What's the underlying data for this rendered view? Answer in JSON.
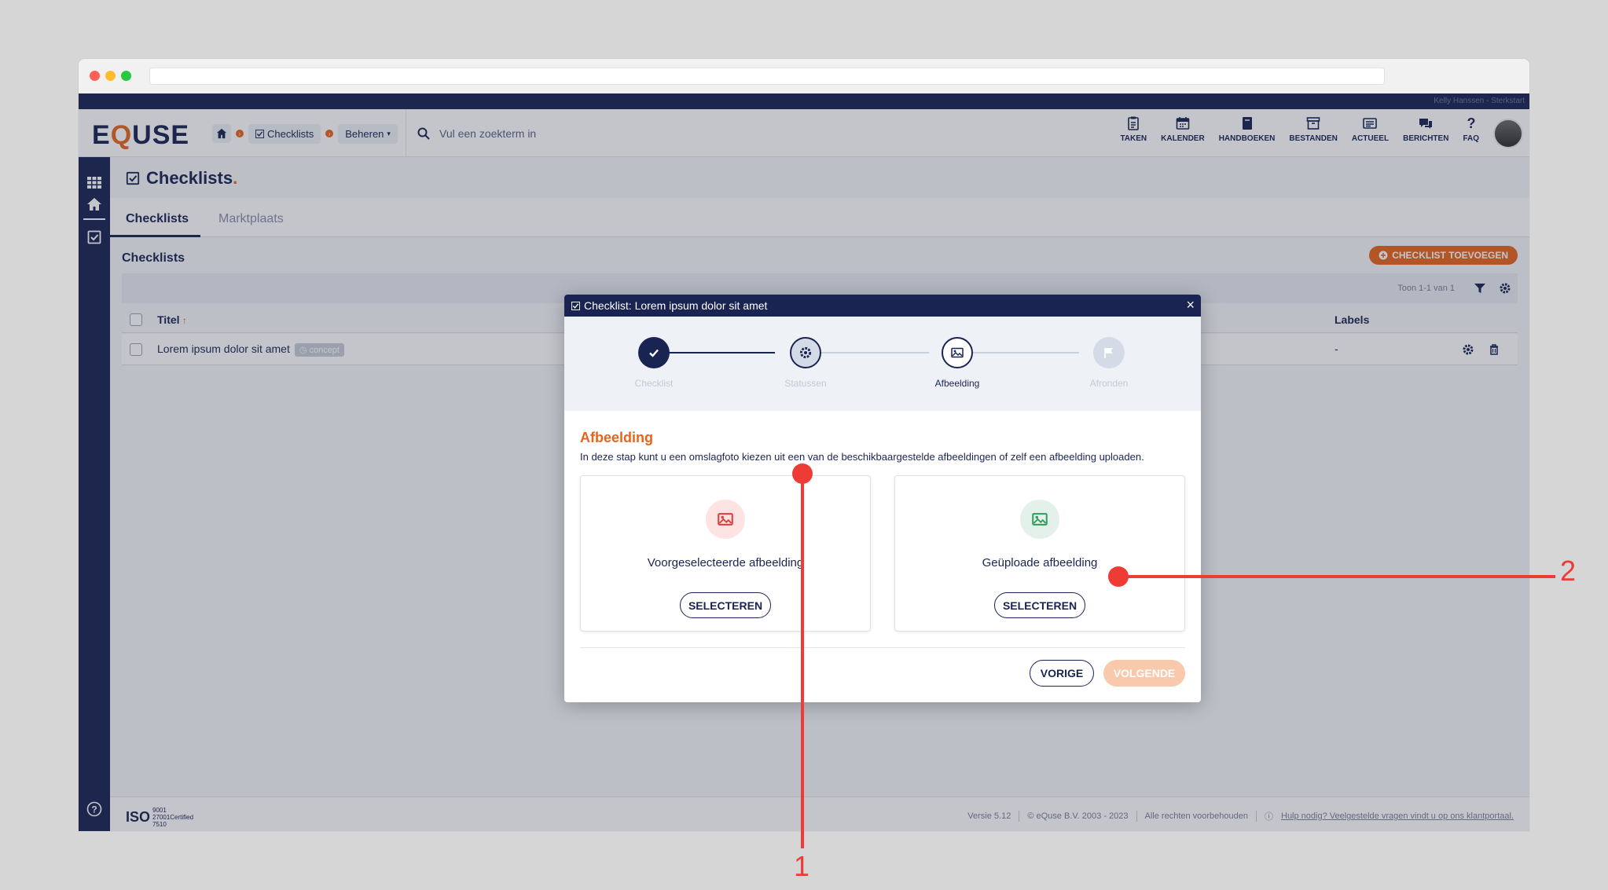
{
  "header": {
    "user_text": "Kelly Hanssen - Sterkstart",
    "logo_left": "E",
    "logo_q": "Q",
    "logo_right": "USE",
    "breadcrumbs": {
      "item1": "Checklists",
      "item2": "Beheren"
    },
    "search_placeholder": "Vul een zoekterm in",
    "nav": [
      {
        "label": "TAKEN",
        "icon": "clipboard-icon"
      },
      {
        "label": "KALENDER",
        "icon": "calendar-icon"
      },
      {
        "label": "HANDBOEKEN",
        "icon": "book-icon"
      },
      {
        "label": "BESTANDEN",
        "icon": "archive-icon"
      },
      {
        "label": "ACTUEEL",
        "icon": "news-icon"
      },
      {
        "label": "BERICHTEN",
        "icon": "chat-icon"
      },
      {
        "label": "FAQ",
        "icon": "question-icon"
      }
    ]
  },
  "page": {
    "title": "Checklists",
    "title_dot": ".",
    "tabs": [
      {
        "label": "Checklists",
        "active": true
      },
      {
        "label": "Marktplaats",
        "active": false
      }
    ],
    "section_title": "Checklists",
    "add_button": "CHECKLIST TOEVOEGEN",
    "count_text": "Toon 1-1 van 1",
    "columns": {
      "title": "Titel",
      "labels": "Labels"
    },
    "rows": [
      {
        "title": "Lorem ipsum dolor sit amet",
        "badge": "concept",
        "labels": "-"
      }
    ]
  },
  "footer": {
    "iso_main": "ISO",
    "iso_lines": [
      "9001",
      "27001Certified",
      "7510"
    ],
    "version": "Versie 5.12",
    "copyright": "© eQuse B.V. 2003 - 2023",
    "rights": "Alle rechten voorbehouden",
    "help": "Hulp nodig? Veelgestelde vragen vindt u op ons klantportaal."
  },
  "modal": {
    "title": "Checklist: Lorem ipsum dolor sit amet",
    "steps": [
      {
        "label": "Checklist",
        "state": "done"
      },
      {
        "label": "Statussen",
        "state": "visited"
      },
      {
        "label": "Afbeelding",
        "state": "current"
      },
      {
        "label": "Afronden",
        "state": "todo"
      }
    ],
    "heading": "Afbeelding",
    "description": "In deze stap kunt u een omslagfoto kiezen uit een van de beschikbaargestelde afbeeldingen of zelf een afbeelding uploaden.",
    "cards": [
      {
        "title": "Voorgeselecteerde afbeelding",
        "button": "SELECTEREN",
        "icon_color": "#e23b3b",
        "icon_bg": "#fde3e1"
      },
      {
        "title": "Geüploade afbeelding",
        "button": "SELECTEREN",
        "icon_color": "#2e9e5b",
        "icon_bg": "#e4f0ea"
      }
    ],
    "prev_button": "VORIGE",
    "next_button": "VOLGENDE"
  },
  "annotations": {
    "one": "1",
    "two": "2"
  },
  "colors": {
    "navy": "#1a2452",
    "orange": "#e8641c",
    "annotation": "#ee3b35"
  }
}
